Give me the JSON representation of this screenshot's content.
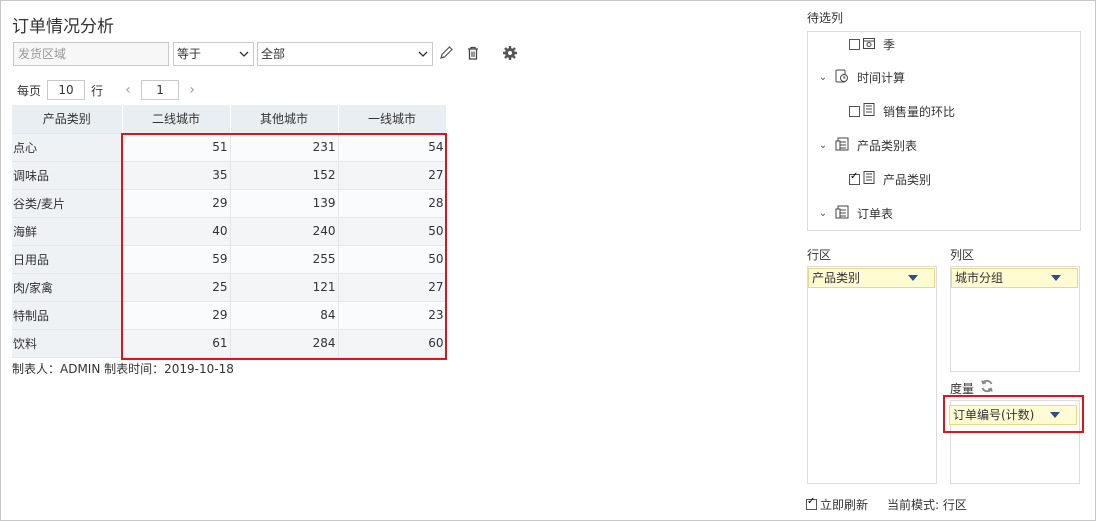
{
  "page": {
    "title": "订单情况分析"
  },
  "filter": {
    "field_placeholder": "发货区域",
    "operator": "等于",
    "value": "全部",
    "edit_icon": "pencil-icon",
    "delete_icon": "trash-icon",
    "settings_icon": "gear-icon"
  },
  "pager": {
    "per_page_label": "每页",
    "per_page_value": "10",
    "rows_label": "行",
    "current_page": "1",
    "prev": "‹",
    "next": "›"
  },
  "table": {
    "headers": [
      "产品类别",
      "二线城市",
      "其他城市",
      "一线城市"
    ],
    "rows": [
      {
        "category": "点心",
        "values": [
          "51",
          "231",
          "54"
        ]
      },
      {
        "category": "调味品",
        "values": [
          "35",
          "152",
          "27"
        ]
      },
      {
        "category": "谷类/麦片",
        "values": [
          "29",
          "139",
          "28"
        ]
      },
      {
        "category": "海鲜",
        "values": [
          "40",
          "240",
          "50"
        ]
      },
      {
        "category": "日用品",
        "values": [
          "59",
          "255",
          "50"
        ]
      },
      {
        "category": "肉/家禽",
        "values": [
          "25",
          "121",
          "27"
        ]
      },
      {
        "category": "特制品",
        "values": [
          "29",
          "84",
          "23"
        ]
      },
      {
        "category": "饮料",
        "values": [
          "61",
          "284",
          "60"
        ]
      }
    ],
    "highlight_color": "#d9161b"
  },
  "footer": {
    "note": "制表人：ADMIN  制表时间：2019-10-18"
  },
  "right_panel": {
    "candidates_label": "待选列",
    "tree": [
      {
        "label": "季",
        "icon": "calendar-field-icon",
        "checkbox": true,
        "checked": false
      },
      {
        "label": "时间计算",
        "icon": "time-calc-icon",
        "expandable": true
      },
      {
        "label": "销售量的环比",
        "icon": "measure-field-icon",
        "checkbox": true,
        "checked": false
      },
      {
        "label": "产品类别表",
        "icon": "table-icon",
        "expandable": true
      },
      {
        "label": "产品类别",
        "icon": "dimension-field-icon",
        "checkbox": true,
        "checked": true
      },
      {
        "label": "订单表",
        "icon": "table-icon",
        "expandable": true
      }
    ],
    "row_area_label": "行区",
    "col_area_label": "列区",
    "row_field": "产品类别",
    "col_field": "城市分组",
    "measure_label": "度量",
    "measure_field": "订单编号(计数)",
    "refresh_label": "立即刷新",
    "refresh_checked": true,
    "mode_label": "当前模式: 行区",
    "pill_color": "#fffbd2",
    "arrow_color": "#2d4f86"
  }
}
